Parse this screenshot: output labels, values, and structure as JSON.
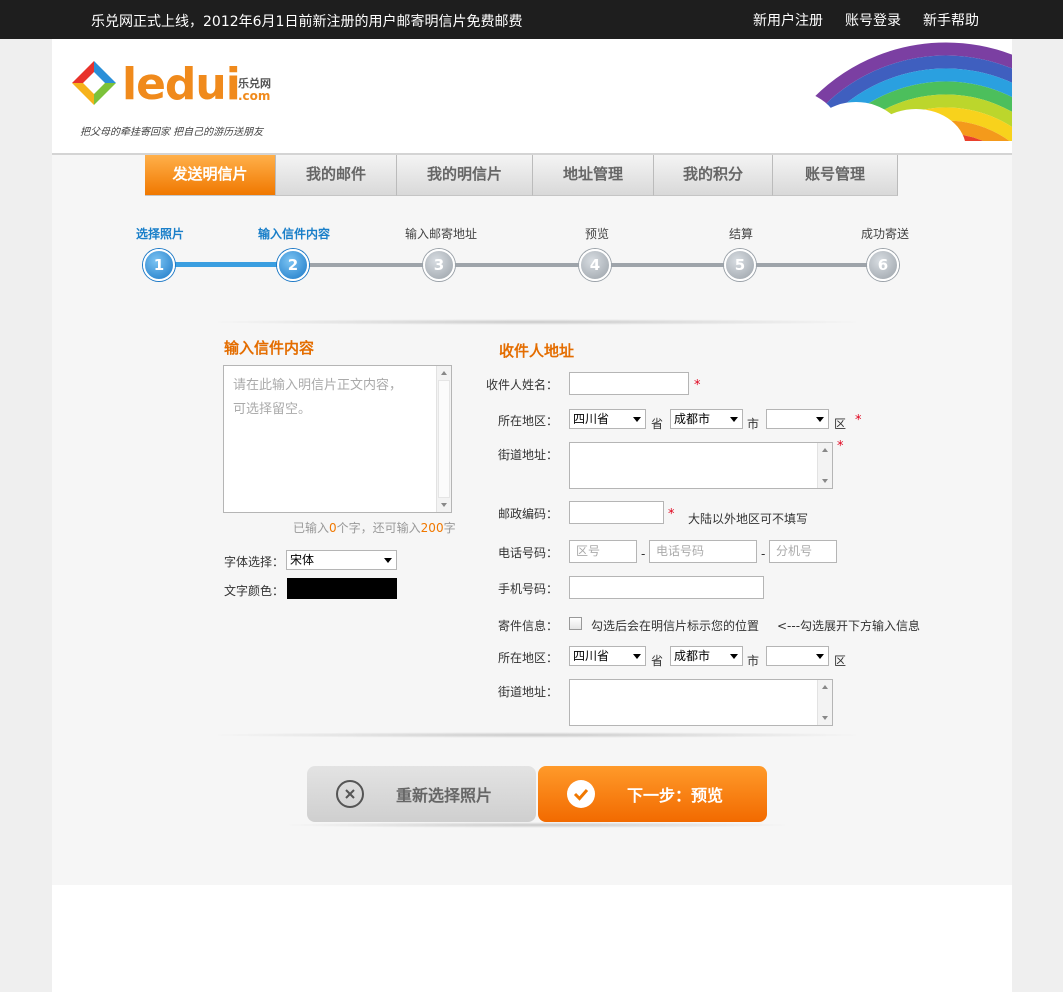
{
  "topbar": {
    "notice": "乐兑网正式上线，2012年6月1日前新注册的用户邮寄明信片免费邮费",
    "links": [
      "新用户注册",
      "账号登录",
      "新手帮助"
    ]
  },
  "logo": {
    "brand": "ledui",
    "brand_cn": "乐兑网",
    "brand_com": ".com",
    "slogan": "把父母的牵挂寄回家  把自己的游历送朋友"
  },
  "nav": {
    "tabs": [
      "发送明信片",
      "我的邮件",
      "我的明信片",
      "地址管理",
      "我的积分",
      "账号管理"
    ],
    "active_index": 0
  },
  "steps": {
    "items": [
      {
        "label": "选择照片",
        "num": "1",
        "done": true
      },
      {
        "label": "输入信件内容",
        "num": "2",
        "done": true
      },
      {
        "label": "输入邮寄地址",
        "num": "3",
        "done": false
      },
      {
        "label": "预览",
        "num": "4",
        "done": false
      },
      {
        "label": "结算",
        "num": "5",
        "done": false
      },
      {
        "label": "成功寄送",
        "num": "6",
        "done": false
      }
    ]
  },
  "letter": {
    "title": "输入信件内容",
    "placeholder_line1": "请在此输入明信片正文内容，",
    "placeholder_line2": "可选择留空。",
    "count_pre": "已输入",
    "count_used": "0",
    "count_mid": "个字，还可输入",
    "count_left": "200",
    "count_post": "字",
    "font_label": "字体选择：",
    "font_value": "宋体",
    "color_label": "文字颜色：",
    "color_value": "#000000"
  },
  "recipient": {
    "title": "收件人地址",
    "name_label": "收件人姓名：",
    "region_label": "所在地区：",
    "province": "四川省",
    "province_unit": "省",
    "city": "成都市",
    "city_unit": "市",
    "district": "",
    "district_unit": "区",
    "street_label": "街道地址：",
    "zip_label": "邮政编码：",
    "zip_note": "大陆以外地区可不填写",
    "phone_label": "电话号码：",
    "phone_area_ph": "区号",
    "phone_num_ph": "电话号码",
    "phone_ext_ph": "分机号",
    "mobile_label": "手机号码：",
    "sender_label": "寄件信息：",
    "sender_checkbox": "勾选后会在明信片标示您的位置",
    "sender_hint": "<---勾选展开下方输入信息",
    "sender_region_label": "所在地区：",
    "sender_province": "四川省",
    "sender_city": "成都市",
    "sender_district": "",
    "sender_street_label": "街道地址：",
    "required_mark": "*",
    "dash": "-"
  },
  "buttons": {
    "reselect": "重新选择照片",
    "next": "下一步：预览"
  },
  "colors": {
    "accent_orange": "#f07800",
    "step_blue": "#1b78c6",
    "required_red": "#e0001b"
  }
}
